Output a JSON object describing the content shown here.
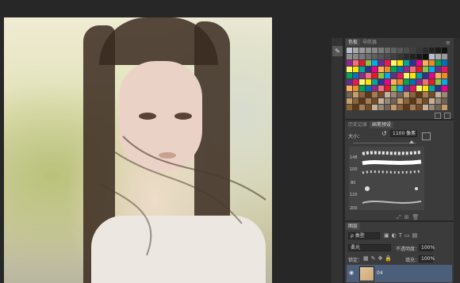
{
  "panels": {
    "swatches": {
      "tabs": [
        {
          "label": "色板",
          "active": true
        },
        {
          "label": "导航器",
          "active": false
        }
      ]
    },
    "brushes": {
      "tabs": [
        {
          "label": "历史记录",
          "active": false
        },
        {
          "label": "画笔预设",
          "active": true
        }
      ],
      "size_label": "大小：",
      "size_value": "1100 像素",
      "sizes": [
        "148",
        "100",
        "80",
        "120",
        "200"
      ]
    },
    "layers": {
      "tab": "图层",
      "filter_kind": "ρ 类型",
      "blend_mode": "柔光",
      "opacity_label": "不透明度：",
      "opacity_value": "100%",
      "lock_label": "锁定：",
      "fill_label": "填充：",
      "fill_value": "100%",
      "layer_name": "04"
    }
  },
  "swatch_colors": {
    "row0": [
      "#b9bfd2",
      "#a8a8a8",
      "#9a9a9a",
      "#8e8e8e",
      "#888",
      "#7a7a7a",
      "#6c6c6c",
      "#606060",
      "#565656",
      "#4c4c4c",
      "#404040",
      "#363636",
      "#2c2c2c",
      "#232323",
      "#1a1a1a",
      "#111"
    ],
    "palette": [
      "#e8192c",
      "#f08a24",
      "#ffe400",
      "#8cc63e",
      "#00a651",
      "#00a99d",
      "#00aeef",
      "#0072bc",
      "#2e3192",
      "#662d91",
      "#92278f",
      "#ec008c",
      "#ed145b",
      "#f26d7d",
      "#fbaf5d",
      "#fff568"
    ]
  }
}
